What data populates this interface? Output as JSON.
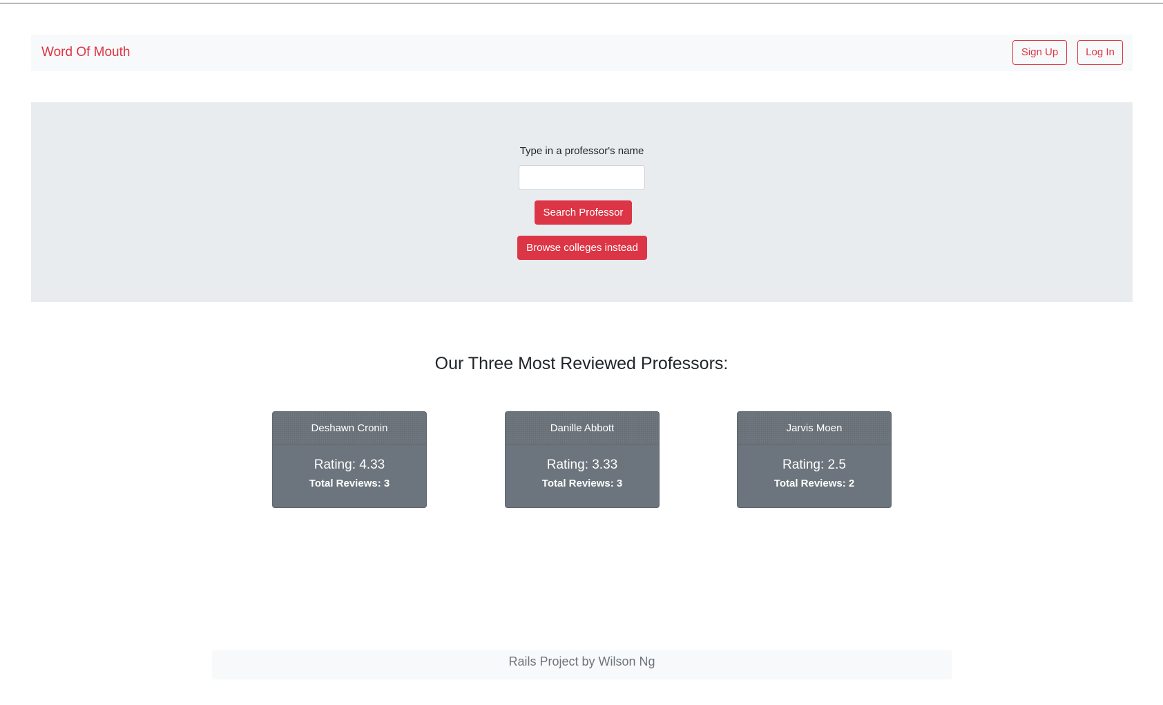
{
  "navbar": {
    "brand": "Word Of Mouth",
    "signup_label": "Sign Up",
    "login_label": "Log In"
  },
  "search": {
    "label": "Type in a professor's name",
    "value": "",
    "placeholder": "",
    "search_button": "Search Professor",
    "browse_button": "Browse colleges instead"
  },
  "top_professors": {
    "heading": "Our Three Most Reviewed Professors:",
    "cards": [
      {
        "name": "Deshawn Cronin",
        "rating": "Rating: 4.33",
        "reviews": "Total Reviews: 3"
      },
      {
        "name": "Danille Abbott",
        "rating": "Rating: 3.33",
        "reviews": "Total Reviews: 3"
      },
      {
        "name": "Jarvis Moen",
        "rating": "Rating: 2.5",
        "reviews": "Total Reviews: 2"
      }
    ]
  },
  "footer": {
    "text": "Rails Project by Wilson Ng"
  },
  "colors": {
    "accent": "#dc3545",
    "card_background": "#6c757d",
    "jumbotron_background": "#e9ecef",
    "navbar_background": "#f8f9fa"
  }
}
